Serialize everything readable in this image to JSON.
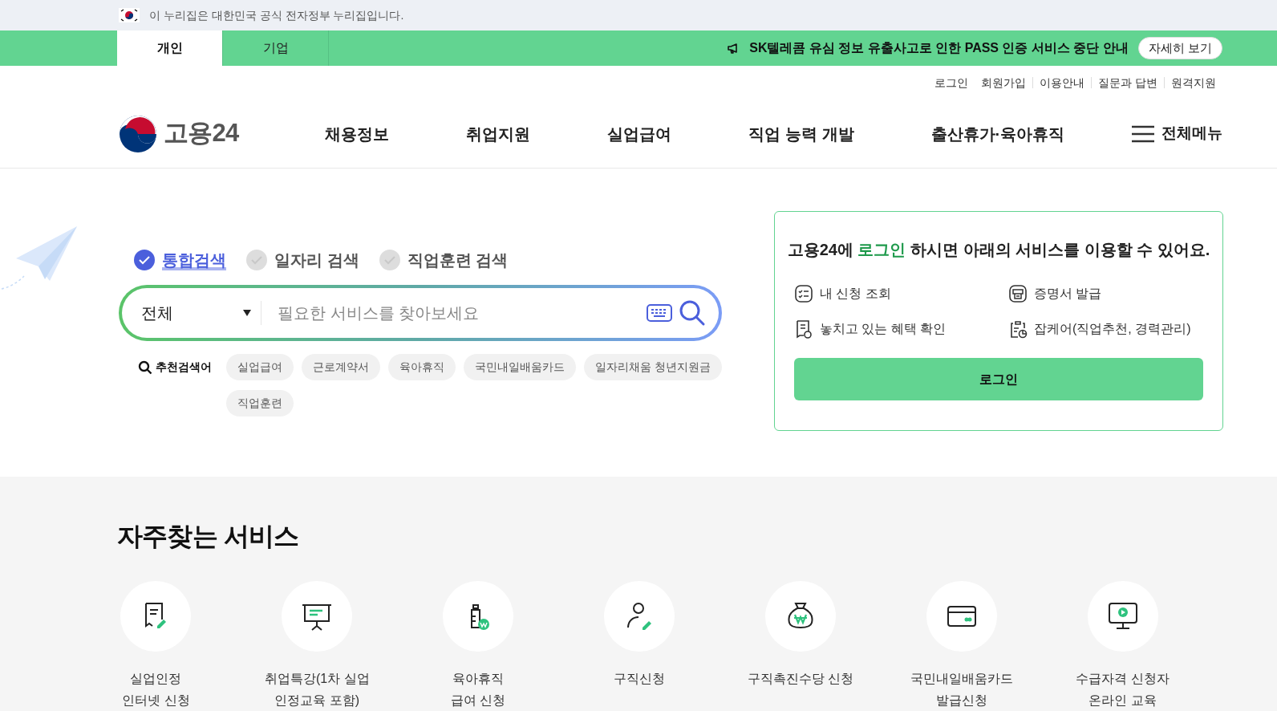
{
  "gov_banner": {
    "text": "이 누리집은 대한민국 공식 전자정부 누리집입니다."
  },
  "audience_tabs": [
    {
      "label": "개인",
      "selected": true
    },
    {
      "label": "기업",
      "selected": false
    }
  ],
  "notice": {
    "text": "SK텔레콤 유심 정보 유출사고로 인한 PASS 인증 서비스 중단 안내",
    "button": "자세히 보기"
  },
  "util_links": [
    "로그인",
    "회원가입",
    "이용안내",
    "질문과 답변",
    "원격지원"
  ],
  "logo": {
    "text": "고용24"
  },
  "nav": [
    "채용정보",
    "취업지원",
    "실업급여",
    "직업 능력 개발",
    "출산휴가·육아휴직"
  ],
  "all_menu": "전체메뉴",
  "search": {
    "scopes": [
      {
        "label": "통합검색",
        "selected": true
      },
      {
        "label": "일자리 검색",
        "selected": false
      },
      {
        "label": "직업훈련 검색",
        "selected": false
      }
    ],
    "category": "전체",
    "placeholder": "필요한 서비스를 찾아보세요",
    "recommended_label": "추천검색어",
    "keywords": [
      "실업급여",
      "근로계약서",
      "육아휴직",
      "국민내일배움카드",
      "일자리채움 청년지원금",
      "직업훈련"
    ]
  },
  "login_card": {
    "message_lead": "고용24에 ",
    "message_link": "로그인",
    "message_rest": " 하시면 아래의 서비스를 이용할 수 있어요.",
    "services": [
      {
        "kind": "list",
        "label": "내 신청 조회"
      },
      {
        "kind": "certificate",
        "label": "증명서 발급"
      },
      {
        "kind": "benefit",
        "label": "놓치고 있는 혜택 확인"
      },
      {
        "kind": "clipboard",
        "label": "잡케어(직업추천, 경력관리)"
      }
    ],
    "button": "로그인"
  },
  "frequent": {
    "title": "자주찾는 서비스",
    "items": [
      {
        "kind": "document",
        "lines": [
          "실업인정",
          "인터넷 신청"
        ]
      },
      {
        "kind": "lecture",
        "lines": [
          "취업특강(1차 실업",
          "인정교육 포함)"
        ]
      },
      {
        "kind": "bottle",
        "lines": [
          "육아휴직",
          "급여 신청"
        ]
      },
      {
        "kind": "person",
        "lines": [
          "구직신청"
        ]
      },
      {
        "kind": "moneybag",
        "lines": [
          "구직촉진수당 신청"
        ]
      },
      {
        "kind": "card",
        "lines": [
          "국민내일배움카드",
          "발급신청"
        ]
      },
      {
        "kind": "monitor",
        "lines": [
          "수급자격 신청자",
          "온라인 교육"
        ]
      }
    ]
  }
}
